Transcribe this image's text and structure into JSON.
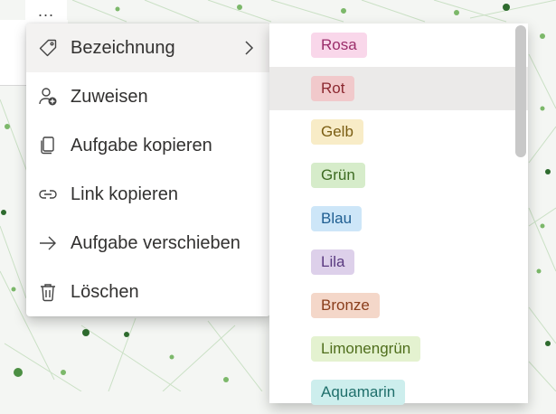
{
  "card": {
    "more_label": "..."
  },
  "menu": {
    "items": [
      {
        "label": "Bezeichnung",
        "icon": "tag-icon"
      },
      {
        "label": "Zuweisen",
        "icon": "assign-person-icon"
      },
      {
        "label": "Aufgabe kopieren",
        "icon": "copy-icon"
      },
      {
        "label": "Link kopieren",
        "icon": "link-icon"
      },
      {
        "label": "Aufgabe verschieben",
        "icon": "arrow-right-icon"
      },
      {
        "label": "Löschen",
        "icon": "trash-icon"
      }
    ]
  },
  "labels": {
    "items": [
      {
        "label": "Rosa",
        "bg": "#f9d7ea",
        "fg": "#9b2d6a"
      },
      {
        "label": "Rot",
        "bg": "#f1c9cb",
        "fg": "#8c2830"
      },
      {
        "label": "Gelb",
        "bg": "#f8ecc7",
        "fg": "#7a5d12"
      },
      {
        "label": "Grün",
        "bg": "#d6ecca",
        "fg": "#3d6b22"
      },
      {
        "label": "Blau",
        "bg": "#cde6f8",
        "fg": "#1f5e91"
      },
      {
        "label": "Lila",
        "bg": "#ddd0ea",
        "fg": "#5a3a80"
      },
      {
        "label": "Bronze",
        "bg": "#f4d7c9",
        "fg": "#8a3e1c"
      },
      {
        "label": "Limonengrün",
        "bg": "#e4f2d0",
        "fg": "#4f6e1c"
      },
      {
        "label": "Aquamarin",
        "bg": "#cdeeed",
        "fg": "#1f6f6b"
      }
    ]
  }
}
